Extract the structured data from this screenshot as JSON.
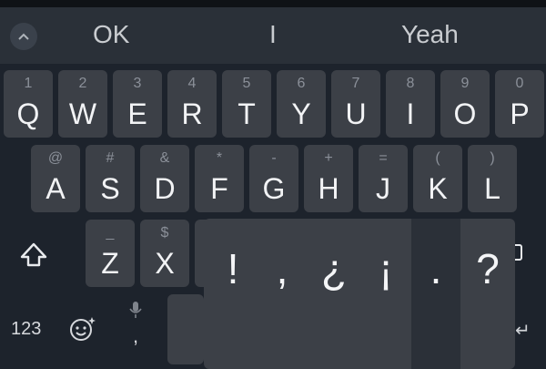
{
  "suggestions": [
    "OK",
    "I",
    "Yeah"
  ],
  "row1": [
    {
      "hint": "1",
      "label": "Q"
    },
    {
      "hint": "2",
      "label": "W"
    },
    {
      "hint": "3",
      "label": "E"
    },
    {
      "hint": "4",
      "label": "R"
    },
    {
      "hint": "5",
      "label": "T"
    },
    {
      "hint": "6",
      "label": "Y"
    },
    {
      "hint": "7",
      "label": "U"
    },
    {
      "hint": "8",
      "label": "I"
    },
    {
      "hint": "9",
      "label": "O"
    },
    {
      "hint": "0",
      "label": "P"
    }
  ],
  "row2": [
    {
      "hint": "@",
      "label": "A"
    },
    {
      "hint": "#",
      "label": "S"
    },
    {
      "hint": "&",
      "label": "D"
    },
    {
      "hint": "*",
      "label": "F"
    },
    {
      "hint": "-",
      "label": "G"
    },
    {
      "hint": "+",
      "label": "H"
    },
    {
      "hint": "=",
      "label": "J"
    },
    {
      "hint": "(",
      "label": "K"
    },
    {
      "hint": ")",
      "label": "L"
    }
  ],
  "row3": [
    {
      "hint": "_",
      "label": "Z"
    },
    {
      "hint": "$",
      "label": "X"
    }
  ],
  "bottom": {
    "numbers_label": "123",
    "comma_label": ","
  },
  "popup": {
    "chars": [
      "!",
      ",",
      "¿",
      "¡",
      ".",
      "?"
    ],
    "selected_index": 4
  },
  "colors": {
    "background": "#1d232c",
    "key": "#3c4047",
    "suggestion_bar": "#2a3038"
  }
}
